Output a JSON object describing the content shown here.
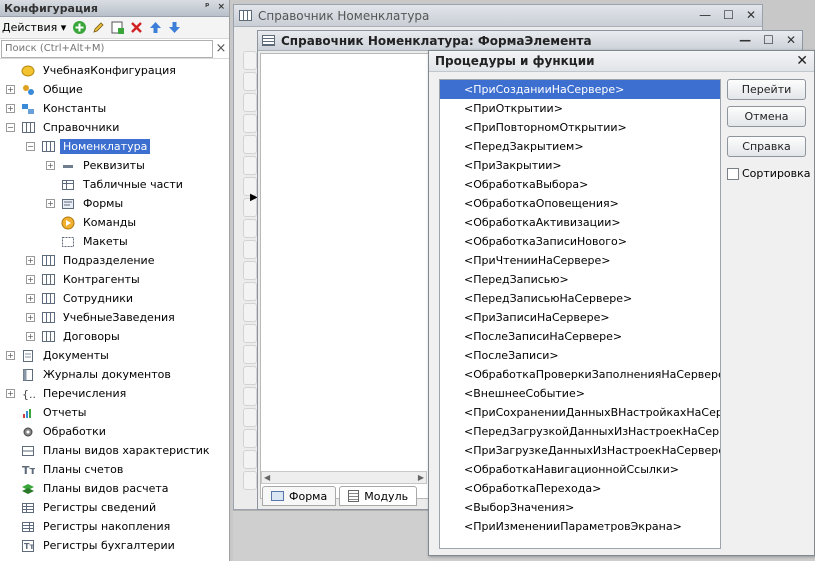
{
  "config_panel": {
    "title": "Конфигурация",
    "title_buttons": [
      "ᵖ",
      "×"
    ],
    "actions_label": "Действия ▾",
    "search_placeholder": "Поиск (Ctrl+Alt+M)",
    "tree": [
      {
        "label": "УчебнаяКонфигурация",
        "level": 0,
        "exp": "none",
        "icon": "config-root-icon"
      },
      {
        "label": "Общие",
        "level": 0,
        "exp": "+",
        "icon": "common-icon"
      },
      {
        "label": "Константы",
        "level": 0,
        "exp": "+",
        "icon": "constants-icon"
      },
      {
        "label": "Справочники",
        "level": 0,
        "exp": "−",
        "icon": "catalogs-icon"
      },
      {
        "label": "Номенклатура",
        "level": 1,
        "exp": "−",
        "icon": "catalog-icon",
        "selected": true
      },
      {
        "label": "Реквизиты",
        "level": 2,
        "exp": "+",
        "icon": "attributes-icon"
      },
      {
        "label": "Табличные части",
        "level": 2,
        "exp": "none",
        "icon": "tabular-sections-icon"
      },
      {
        "label": "Формы",
        "level": 2,
        "exp": "+",
        "icon": "forms-icon"
      },
      {
        "label": "Команды",
        "level": 2,
        "exp": "none",
        "icon": "commands-icon"
      },
      {
        "label": "Макеты",
        "level": 2,
        "exp": "none",
        "icon": "templates-icon"
      },
      {
        "label": "Подразделение",
        "level": 1,
        "exp": "+",
        "icon": "catalog-icon"
      },
      {
        "label": "Контрагенты",
        "level": 1,
        "exp": "+",
        "icon": "catalog-icon"
      },
      {
        "label": "Сотрудники",
        "level": 1,
        "exp": "+",
        "icon": "catalog-icon"
      },
      {
        "label": "УчебныеЗаведения",
        "level": 1,
        "exp": "+",
        "icon": "catalog-icon"
      },
      {
        "label": "Договоры",
        "level": 1,
        "exp": "+",
        "icon": "catalog-icon"
      },
      {
        "label": "Документы",
        "level": 0,
        "exp": "+",
        "icon": "documents-icon"
      },
      {
        "label": "Журналы документов",
        "level": 0,
        "exp": "none",
        "icon": "journals-icon"
      },
      {
        "label": "Перечисления",
        "level": 0,
        "exp": "+",
        "icon": "enums-icon"
      },
      {
        "label": "Отчеты",
        "level": 0,
        "exp": "none",
        "icon": "reports-icon"
      },
      {
        "label": "Обработки",
        "level": 0,
        "exp": "none",
        "icon": "processors-icon"
      },
      {
        "label": "Планы видов характеристик",
        "level": 0,
        "exp": "none",
        "icon": "characteristics-icon"
      },
      {
        "label": "Планы счетов",
        "level": 0,
        "exp": "none",
        "icon": "chart-of-accounts-icon"
      },
      {
        "label": "Планы видов расчета",
        "level": 0,
        "exp": "none",
        "icon": "calculation-types-icon"
      },
      {
        "label": "Регистры сведений",
        "level": 0,
        "exp": "none",
        "icon": "info-registers-icon"
      },
      {
        "label": "Регистры накопления",
        "level": 0,
        "exp": "none",
        "icon": "accumulation-registers-icon"
      },
      {
        "label": "Регистры бухгалтерии",
        "level": 0,
        "exp": "none",
        "icon": "accounting-registers-icon"
      }
    ]
  },
  "ref_window": {
    "title": "Справочник Номенклатура"
  },
  "form_window": {
    "title": "Справочник Номенклатура: ФормаЭлемента",
    "tabs": [
      {
        "label": "Форма",
        "icon": "form-tab-icon"
      },
      {
        "label": "Модуль",
        "icon": "module-tab-icon"
      }
    ]
  },
  "proc_dialog": {
    "title": "Процедуры и функции",
    "buttons": {
      "go": "Перейти",
      "cancel": "Отмена",
      "help": "Справка"
    },
    "sort_label": "Сортировка",
    "items": [
      "<ПриСозданииНаСервере>",
      "<ПриОткрытии>",
      "<ПриПовторномОткрытии>",
      "<ПередЗакрытием>",
      "<ПриЗакрытии>",
      "<ОбработкаВыбора>",
      "<ОбработкаОповещения>",
      "<ОбработкаАктивизации>",
      "<ОбработкаЗаписиНового>",
      "<ПриЧтенииНаСервере>",
      "<ПередЗаписью>",
      "<ПередЗаписьюНаСервере>",
      "<ПриЗаписиНаСервере>",
      "<ПослеЗаписиНаСервере>",
      "<ПослеЗаписи>",
      "<ОбработкаПроверкиЗаполненияНаСервере>",
      "<ВнешнееСобытие>",
      "<ПриСохраненииДанныхВНастройкахНаСерве",
      "<ПередЗагрузкойДанныхИзНастроекНаСерве",
      "<ПриЗагрузкеДанныхИзНастроекНаСервере>",
      "<ОбработкаНавигационнойСсылки>",
      "<ОбработкаПерехода>",
      "<ВыборЗначения>",
      "<ПриИзмененииПараметровЭкрана>"
    ],
    "selected_index": 0
  }
}
